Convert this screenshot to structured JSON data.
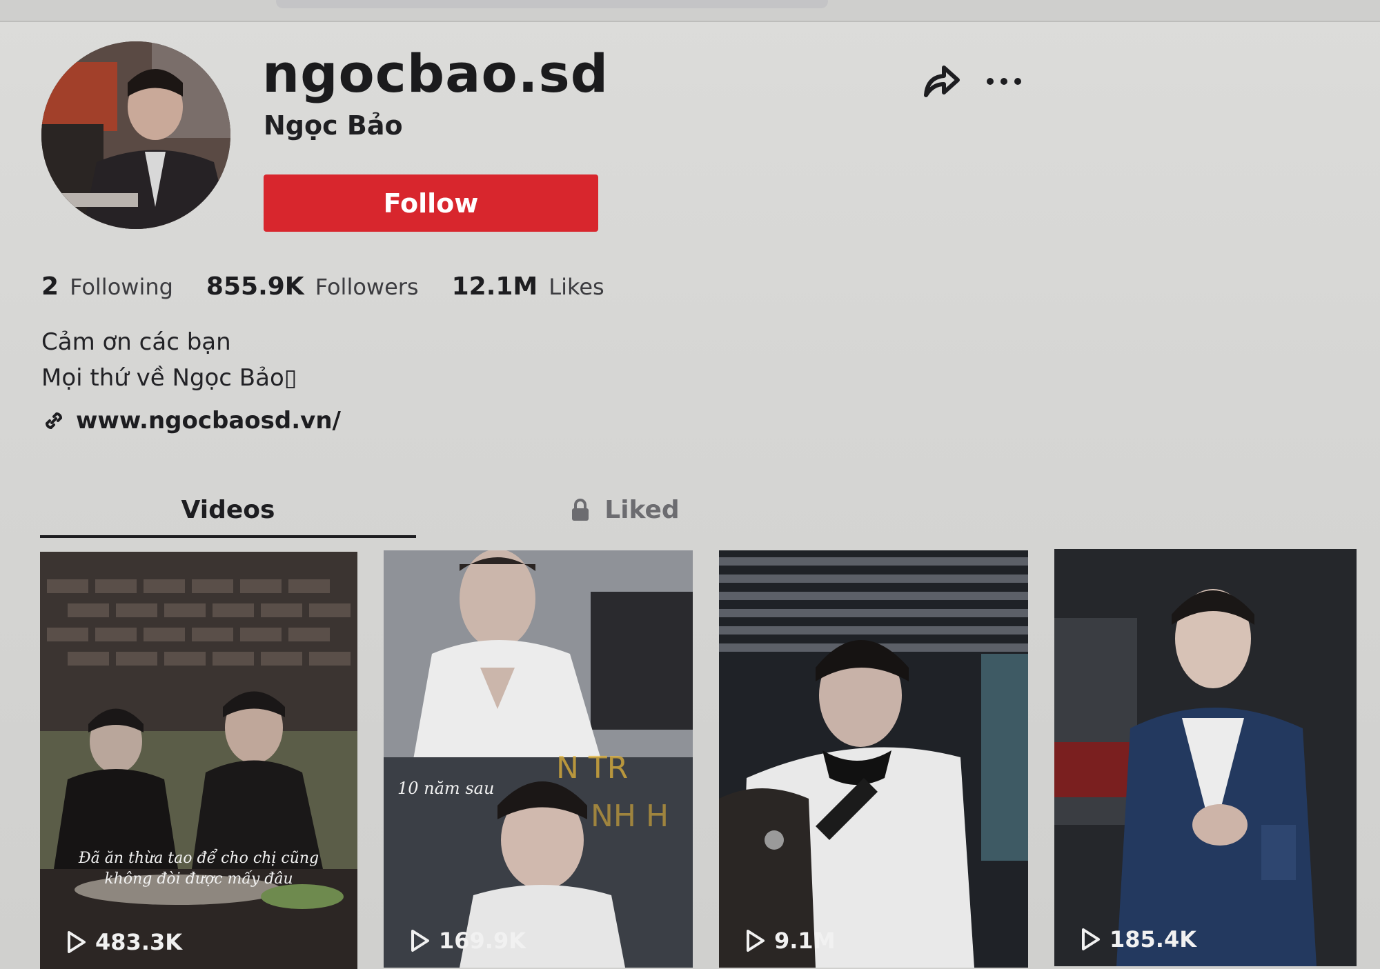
{
  "profile": {
    "username": "ngocbao.sd",
    "display_name": "Ngọc Bảo",
    "follow_label": "Follow"
  },
  "stats": {
    "following_count": "2",
    "following_label": "Following",
    "followers_count": "855.9K",
    "followers_label": "Followers",
    "likes_count": "12.1M",
    "likes_label": "Likes"
  },
  "bio": {
    "line1": "Cảm ơn các bạn",
    "line2": "Mọi thứ về Ngọc Bảo▯"
  },
  "link": {
    "url_text": "www.ngocbaosd.vn/"
  },
  "tabs": [
    {
      "label": "Videos",
      "active": true
    },
    {
      "label": "Liked",
      "locked": true
    }
  ],
  "videos": [
    {
      "views": "483.3K",
      "caption": "Đã ăn thừa tao để cho chị cũng không đòi được mấy đâu"
    },
    {
      "views": "169.9K",
      "caption": "10 năm sau"
    },
    {
      "views": "9.1M"
    },
    {
      "views": "185.4K"
    }
  ],
  "colors": {
    "follow_button": "#d8262d",
    "background": "#d6d6d4",
    "text": "#1d1d20"
  },
  "icons": {
    "share": "share-arrow-icon",
    "more": "more-dots-icon",
    "link": "link-icon",
    "lock": "lock-icon",
    "play": "play-icon"
  }
}
